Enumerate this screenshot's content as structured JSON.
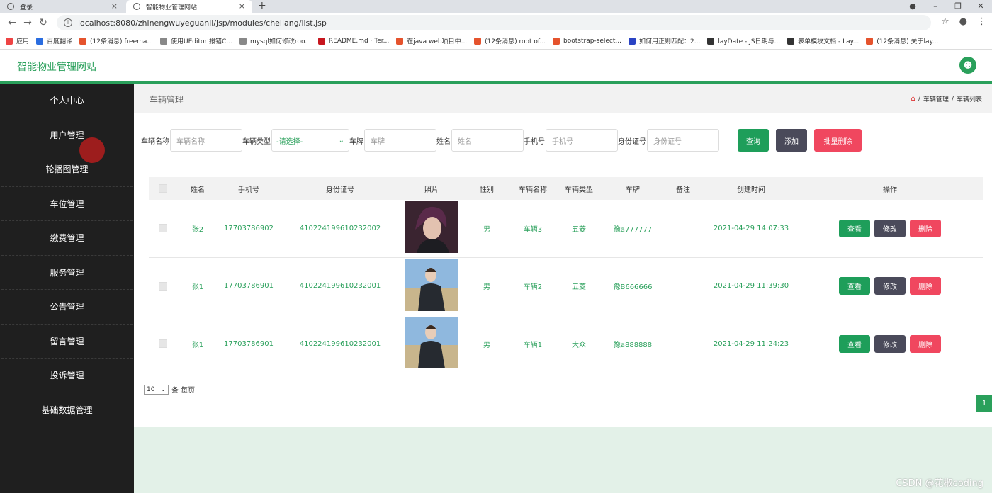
{
  "browser": {
    "tabs": [
      {
        "label": "登录"
      },
      {
        "label": "智能物业管理网站"
      }
    ],
    "url": "localhost:8080/zhinengwuyeguanli/jsp/modules/cheliang/list.jsp",
    "bookmarks": [
      {
        "label": "应用",
        "color": "#e44"
      },
      {
        "label": "百度翻译",
        "color": "#2a6de0"
      },
      {
        "label": "(12条消息) freema...",
        "color": "#e5532d"
      },
      {
        "label": "使用UEditor 报错C...",
        "color": "#888"
      },
      {
        "label": "mysql如何修改roo...",
        "color": "#888"
      },
      {
        "label": "README.md · Ter...",
        "color": "#c7161e"
      },
      {
        "label": "在java web项目中...",
        "color": "#e5532d"
      },
      {
        "label": "(12条消息) root of...",
        "color": "#e5532d"
      },
      {
        "label": "bootstrap-select...",
        "color": "#e5532d"
      },
      {
        "label": "如何用正则匹配：2...",
        "color": "#2a43c4"
      },
      {
        "label": "layDate - JS日期与...",
        "color": "#333"
      },
      {
        "label": "表单模块文档 - Lay...",
        "color": "#333"
      },
      {
        "label": "(12条消息) 关于lay...",
        "color": "#e5532d"
      }
    ]
  },
  "header": {
    "site_title": "智能物业管理网站"
  },
  "sidebar": {
    "items": [
      {
        "label": "个人中心"
      },
      {
        "label": "用户管理"
      },
      {
        "label": "轮播图管理"
      },
      {
        "label": "车位管理"
      },
      {
        "label": "缴费管理"
      },
      {
        "label": "服务管理"
      },
      {
        "label": "公告管理"
      },
      {
        "label": "留言管理"
      },
      {
        "label": "投诉管理"
      },
      {
        "label": "基础数据管理"
      }
    ]
  },
  "page": {
    "title": "车辆管理",
    "breadcrumb": [
      "车辆管理",
      "车辆列表"
    ]
  },
  "filters": {
    "vehicle_name_label": "车辆名称",
    "vehicle_name_placeholder": "车辆名称",
    "vehicle_type_label": "车辆类型",
    "vehicle_type_value": "-请选择-",
    "plate_label": "车牌",
    "plate_placeholder": "车牌",
    "name_label": "姓名",
    "name_placeholder": "姓名",
    "phone_label": "手机号",
    "phone_placeholder": "手机号",
    "idcard_label": "身份证号",
    "idcard_placeholder": "身份证号",
    "search_button": "查询",
    "add_button": "添加",
    "batch_delete_button": "批量删除"
  },
  "table": {
    "headers": [
      "姓名",
      "手机号",
      "身份证号",
      "照片",
      "性别",
      "车辆名称",
      "车辆类型",
      "车牌",
      "备注",
      "创建时间",
      "操作"
    ],
    "rows": [
      {
        "name": "张2",
        "phone": "17703786902",
        "idcard": "410224199610232002",
        "gender": "男",
        "vehicle": "车辆3",
        "type": "五菱",
        "plate": "豫a777777",
        "remark": "",
        "created": "2021-04-29 14:07:33"
      },
      {
        "name": "张1",
        "phone": "17703786901",
        "idcard": "410224199610232001",
        "gender": "男",
        "vehicle": "车辆2",
        "type": "五菱",
        "plate": "豫B666666",
        "remark": "",
        "created": "2021-04-29 11:39:30"
      },
      {
        "name": "张1",
        "phone": "17703786901",
        "idcard": "410224199610232001",
        "gender": "男",
        "vehicle": "车辆1",
        "type": "大众",
        "plate": "豫a888888",
        "remark": "",
        "created": "2021-04-29 11:24:23"
      }
    ],
    "actions": {
      "view": "查看",
      "edit": "修改",
      "delete": "删除"
    }
  },
  "pagination": {
    "page_size": "10",
    "page_size_suffix": "条 每页",
    "current_page": "1"
  },
  "watermark": "CSDN @花椒coding",
  "colors": {
    "accent": "#2aa05b",
    "sidebar": "#1f1f1f",
    "danger": "#f0475f",
    "dark_button": "#4a4a5a"
  }
}
